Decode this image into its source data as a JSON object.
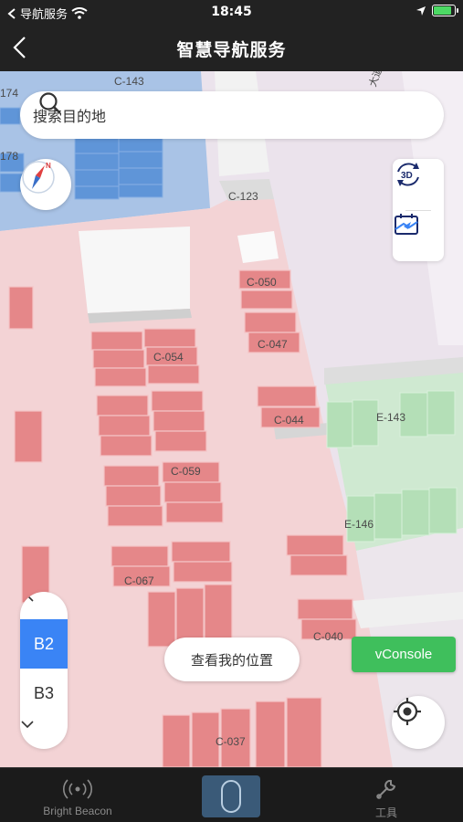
{
  "status_bar": {
    "back_app": "导航服务",
    "time": "18:45",
    "battery_level": 0.85
  },
  "header": {
    "title": "智慧导航服务",
    "back_icon": "chevron-left-icon"
  },
  "search": {
    "placeholder": "搜索目的地",
    "icon": "search-icon"
  },
  "map_tools": {
    "compass_icon": "compass-icon",
    "view_3d_icon": "3d-rotate-icon",
    "view_3d_label": "3D",
    "overview_icon": "map-overview-icon"
  },
  "map_labels": {
    "road": "大道",
    "zones": [
      "174",
      "178",
      "C-143",
      "C-123",
      "C-050",
      "C-054",
      "C-047",
      "C-044",
      "E-143",
      "C-059",
      "E-146",
      "C-067",
      "C-040",
      "C-037"
    ]
  },
  "floors": {
    "items": [
      "B2",
      "B3"
    ],
    "selected": "B2"
  },
  "buttons": {
    "my_location": "查看我的位置",
    "vconsole": "vConsole",
    "locate_icon": "crosshair-icon"
  },
  "tabbar": {
    "items": [
      {
        "label": "Bright Beacon",
        "icon": "beacon-signal-icon"
      },
      {
        "label": "",
        "icon": "beacon-device-icon"
      },
      {
        "label": "工具",
        "icon": "wrench-icon"
      }
    ]
  },
  "colors": {
    "header_bg": "#222222",
    "parking_red": "#e88a8c",
    "zone_pink": "#f2d2d4",
    "zone_blue": "#a8c2e6",
    "zone_green": "#c9e8cc",
    "active_floor": "#3a84f5",
    "vconsole": "#3fbf5c"
  }
}
